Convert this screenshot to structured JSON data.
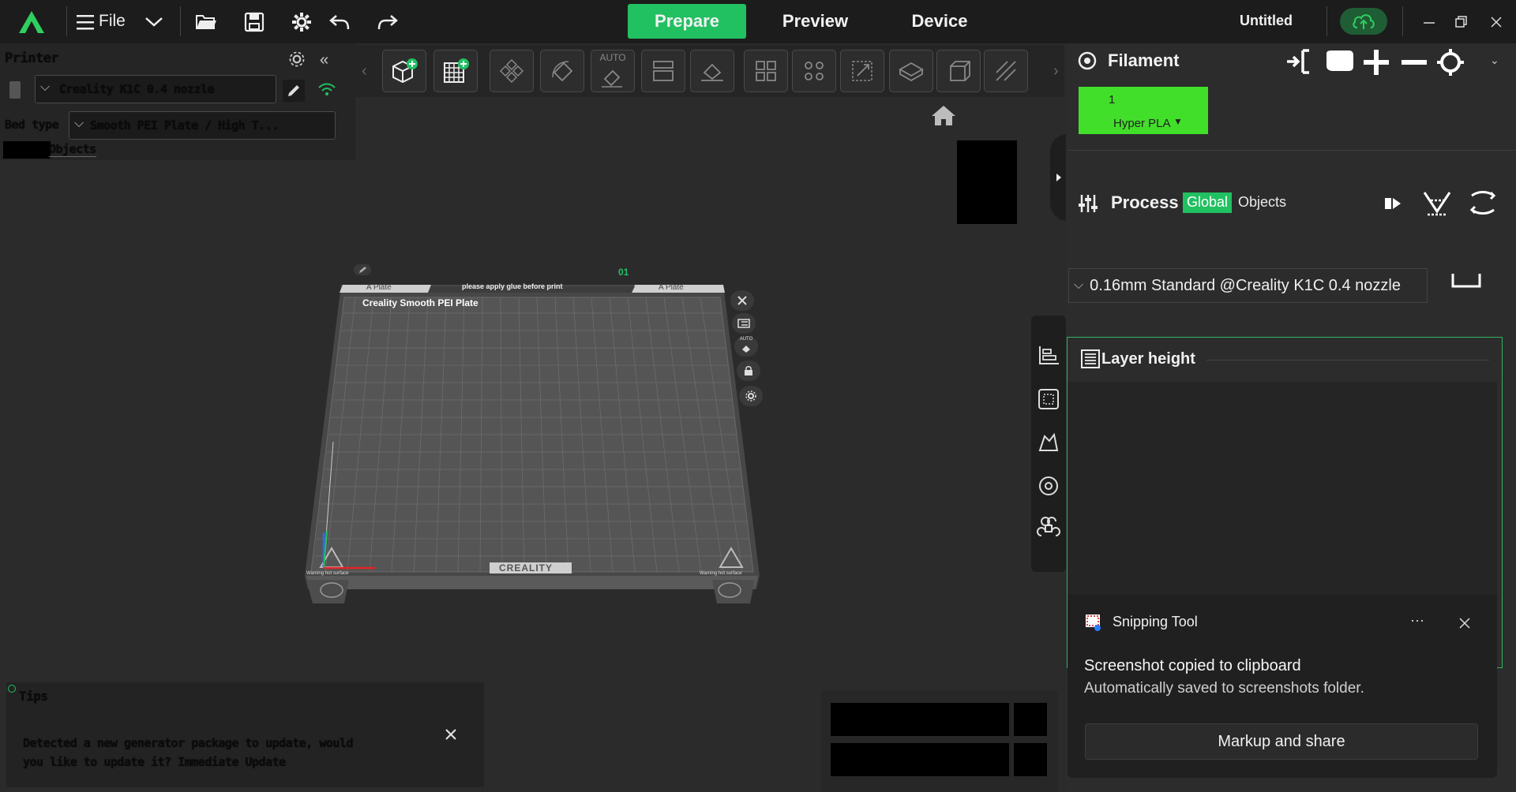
{
  "topbar": {
    "file_label": "File",
    "tabs": {
      "prepare": "Prepare",
      "preview": "Preview",
      "device": "Device"
    },
    "project_title": "Untitled"
  },
  "left_panel": {
    "section_title": "Printer",
    "printer_name": "Creality K1C 0.4 nozzle",
    "bed_type_label": "Bed type",
    "bed_type_value": "Smooth PEI Plate / High T...",
    "tab_objects": "Objects"
  },
  "plate": {
    "number": "01",
    "left_label": "A Plate",
    "right_label": "A Plate",
    "top_notice": "please apply glue before print",
    "name": "Creality Smooth PEI Plate",
    "brand": "CREALITY",
    "warning_left": "Warning hot surface",
    "warning_right": "Warning hot surface",
    "auto_label": "AUTO"
  },
  "toolbar": {
    "auto_label": "AUTO"
  },
  "filament": {
    "title": "Filament",
    "slot_number": "1",
    "slot_name": "Hyper PLA"
  },
  "process": {
    "title": "Process",
    "global": "Global",
    "objects": "Objects",
    "profile": "0.16mm Standard @Creality K1C 0.4 nozzle"
  },
  "layer": {
    "title": "Layer height"
  },
  "toast": {
    "app_name": "Snipping Tool",
    "more": "···",
    "line1": "Screenshot copied to clipboard",
    "line2": "Automatically saved to screenshots folder.",
    "button": "Markup and share"
  },
  "notification": {
    "title": "Tips",
    "body_line1": "Detected a new generator package to update, would",
    "body_line2": "you like to update it? Immediate Update"
  },
  "colors": {
    "accent_green": "#21c061",
    "filament_green": "#42df2a",
    "background": "#2b2b2b"
  }
}
